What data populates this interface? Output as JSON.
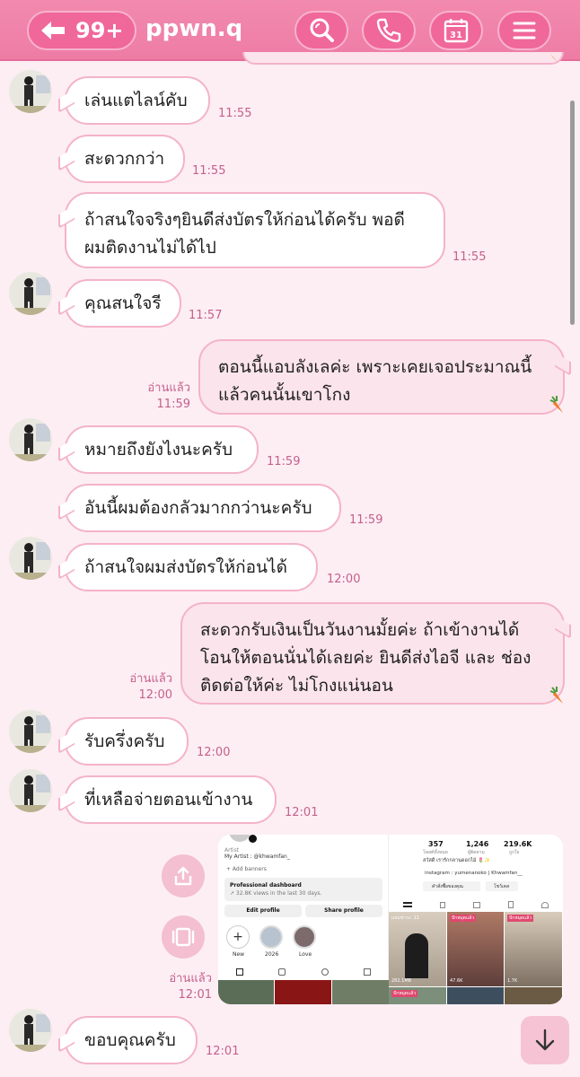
{
  "header": {
    "back_count": "99+",
    "title": "ppwn.q",
    "calendar_day": "31",
    "icons": [
      "arrow-left-icon",
      "search-icon",
      "phone-icon",
      "calendar-icon",
      "menu-icon"
    ]
  },
  "messages": [
    {
      "side": "left",
      "text": "เล่นแตไลน์คับ",
      "time": "11:55"
    },
    {
      "side": "left",
      "text": "สะดวกกว่า",
      "time": "11:55"
    },
    {
      "side": "left",
      "lines": [
        "ถ้าสนใจจริงๆยินดีส่งบัตรให้ก่อนได้ครับ พอดี",
        "ผมติดงานไม่ได้ไป"
      ],
      "time": "11:55"
    },
    {
      "side": "left",
      "text": "คุณสนใจรี",
      "time": "11:57"
    },
    {
      "side": "right",
      "lines": [
        "ตอนนี้แอบลังเลค่ะ เพราะเคยเจอประมาณนี้",
        "แล้วคนนั้นเขาโกง"
      ],
      "read": "อ่านแล้ว",
      "time": "11:59"
    },
    {
      "side": "left",
      "text": "หมายถึงยังไงนะครับ",
      "time": "11:59"
    },
    {
      "side": "left",
      "text": "อันนี้ผมต้องกลัวมากกว่านะครับ",
      "time": "11:59"
    },
    {
      "side": "left",
      "text": "ถ้าสนใจผมส่งบัตรให้ก่อนได้",
      "time": "12:00"
    },
    {
      "side": "right",
      "lines": [
        "สะดวกรับเงินเป็นวันงานมั้ยค่ะ  ถ้าเข้างานได้",
        "โอนให้ตอนนั่นได้เลยค่ะ ยินดีส่งไอจี และ ช่อง",
        "ติดต่อให้ค่ะ ไม่โกงแน่นอน"
      ],
      "read": "อ่านแล้ว",
      "time": "12:00"
    },
    {
      "side": "left",
      "text": "รับครึ่งครับ",
      "time": "12:00"
    },
    {
      "side": "left",
      "text": "ที่เหลือจ่ายตอนเข้างาน",
      "time": "12:01"
    },
    {
      "side": "right-image",
      "read": "อ่านแล้ว",
      "time": "12:01"
    },
    {
      "side": "left",
      "text": "ขอบคุณครับ",
      "time": "12:01"
    }
  ],
  "shared_image": {
    "profile": {
      "artist_label": "Artist",
      "my_artist": "My Artist : @khwamfan_",
      "add_banners": "+ Add banners",
      "dashboard_title": "Professional dashboard",
      "dashboard_sub": "↗ 32.8K views in the last 30 days.",
      "edit_profile": "Edit profile",
      "share_profile": "Share profile",
      "highlights": [
        "New",
        "2026",
        "Love"
      ]
    },
    "stats": {
      "posts": "357",
      "posts_label": "โพสต์ทั้งหมด",
      "followers": "1,246",
      "followers_label": "ผู้ติดตาม",
      "following": "219.6K",
      "following_label": "ถูกใจ",
      "greeting": "สวัสดี เรารักกลานดอกไม้ 🌷✨",
      "instagram": "instagram : yumenanoko | Khwamfan__",
      "chip1": "คำสั่งซื้อของคุณ",
      "chip2": "โชว์เคส",
      "tiles": [
        {
          "top": "แบบข่าวะ: 11",
          "bottom": "282.1MB"
        },
        {
          "top": "ปักหมุดแล้ว",
          "bottom": "47.6K"
        },
        {
          "top": "ปักหมุดแล้ว",
          "bottom": "1.7K"
        }
      ],
      "pinned": "ปักหมุดแล้ว"
    }
  }
}
